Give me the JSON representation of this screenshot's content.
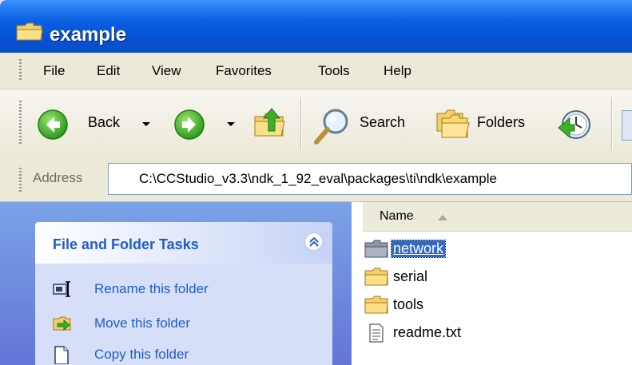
{
  "window": {
    "title": "example"
  },
  "menu": {
    "items": [
      "File",
      "Edit",
      "View",
      "Favorites",
      "Tools",
      "Help"
    ]
  },
  "toolbar": {
    "back_label": "Back",
    "search_label": "Search",
    "folders_label": "Folders"
  },
  "address": {
    "label": "Address",
    "value": "C:\\CCStudio_v3.3\\ndk_1_92_eval\\packages\\ti\\ndk\\example"
  },
  "tasks": {
    "title": "File and Folder Tasks",
    "items": [
      {
        "label": "Rename this folder",
        "icon": "rename-folder-icon"
      },
      {
        "label": "Move this folder",
        "icon": "move-folder-icon"
      },
      {
        "label": "Copy this folder",
        "icon": "copy-folder-icon"
      }
    ]
  },
  "files": {
    "column_name": "Name",
    "items": [
      {
        "name": "network",
        "type": "folder",
        "selected": true
      },
      {
        "name": "serial",
        "type": "folder",
        "selected": false
      },
      {
        "name": "tools",
        "type": "folder",
        "selected": false
      },
      {
        "name": "readme.txt",
        "type": "text-file",
        "selected": false
      }
    ]
  },
  "colors": {
    "titlebar": "#0552d6",
    "task_link": "#215dc6",
    "selection": "#316ac5",
    "folder": "#f5c542"
  }
}
